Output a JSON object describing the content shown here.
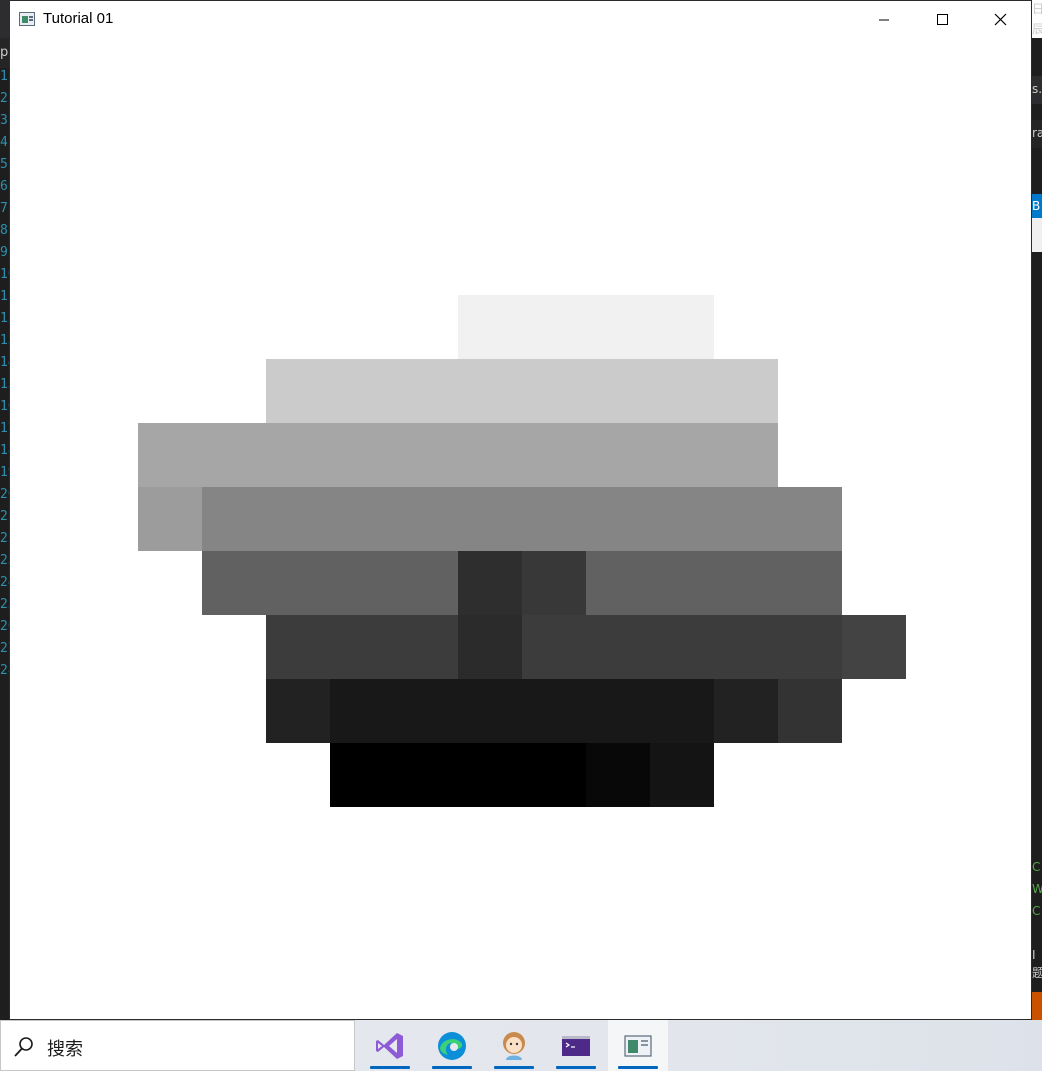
{
  "window": {
    "title": "Tutorial 01",
    "controls": [
      "minimize",
      "maximize",
      "close"
    ]
  },
  "background_editor": {
    "line_numbers": [
      "1",
      "2",
      "3",
      "4",
      "5",
      "6",
      "7",
      "8",
      "9",
      "10",
      "11",
      "12",
      "13",
      "14",
      "15",
      "16",
      "17",
      "18",
      "19",
      "20",
      "21",
      "22",
      "23",
      "24",
      "25",
      "26",
      "27",
      "28"
    ],
    "left_top_text": "u",
    "left_tab_text": "p",
    "right_fragments": [
      "日",
      "辰",
      "s.c",
      "ra",
      "B",
      "C",
      "W",
      "C",
      "I",
      "题"
    ]
  },
  "canvas": {
    "background_color": "#ffffff",
    "blocks": [
      {
        "color": "#f1f1f1"
      },
      {
        "color": "#cbcbcb"
      },
      {
        "color": "#a6a6a6"
      },
      {
        "color": "#9c9c9c"
      },
      {
        "color": "#858585"
      },
      {
        "color": "#616161"
      },
      {
        "color": "#2e2e2e"
      },
      {
        "color": "#383838"
      },
      {
        "color": "#616161"
      },
      {
        "color": "#3c3c3c"
      },
      {
        "color": "#2b2b2b"
      },
      {
        "color": "#3c3c3c"
      },
      {
        "color": "#434343"
      },
      {
        "color": "#222222"
      },
      {
        "color": "#181818"
      },
      {
        "color": "#222222"
      },
      {
        "color": "#333333"
      },
      {
        "color": "#000000"
      },
      {
        "color": "#080808"
      },
      {
        "color": "#141414"
      }
    ]
  },
  "taskbar": {
    "search_label": "搜索",
    "apps": [
      {
        "name": "visual-studio-icon",
        "running": true,
        "active": false
      },
      {
        "name": "edge-icon",
        "running": true,
        "active": false
      },
      {
        "name": "avatar-app-icon",
        "running": true,
        "active": false
      },
      {
        "name": "terminal-icon",
        "running": true,
        "active": false
      },
      {
        "name": "tutorial-window-icon",
        "running": true,
        "active": true
      }
    ]
  },
  "colors": {
    "accent": "#0067c0",
    "editor_bg": "#1e1e1e",
    "line_number": "#2b91af"
  }
}
